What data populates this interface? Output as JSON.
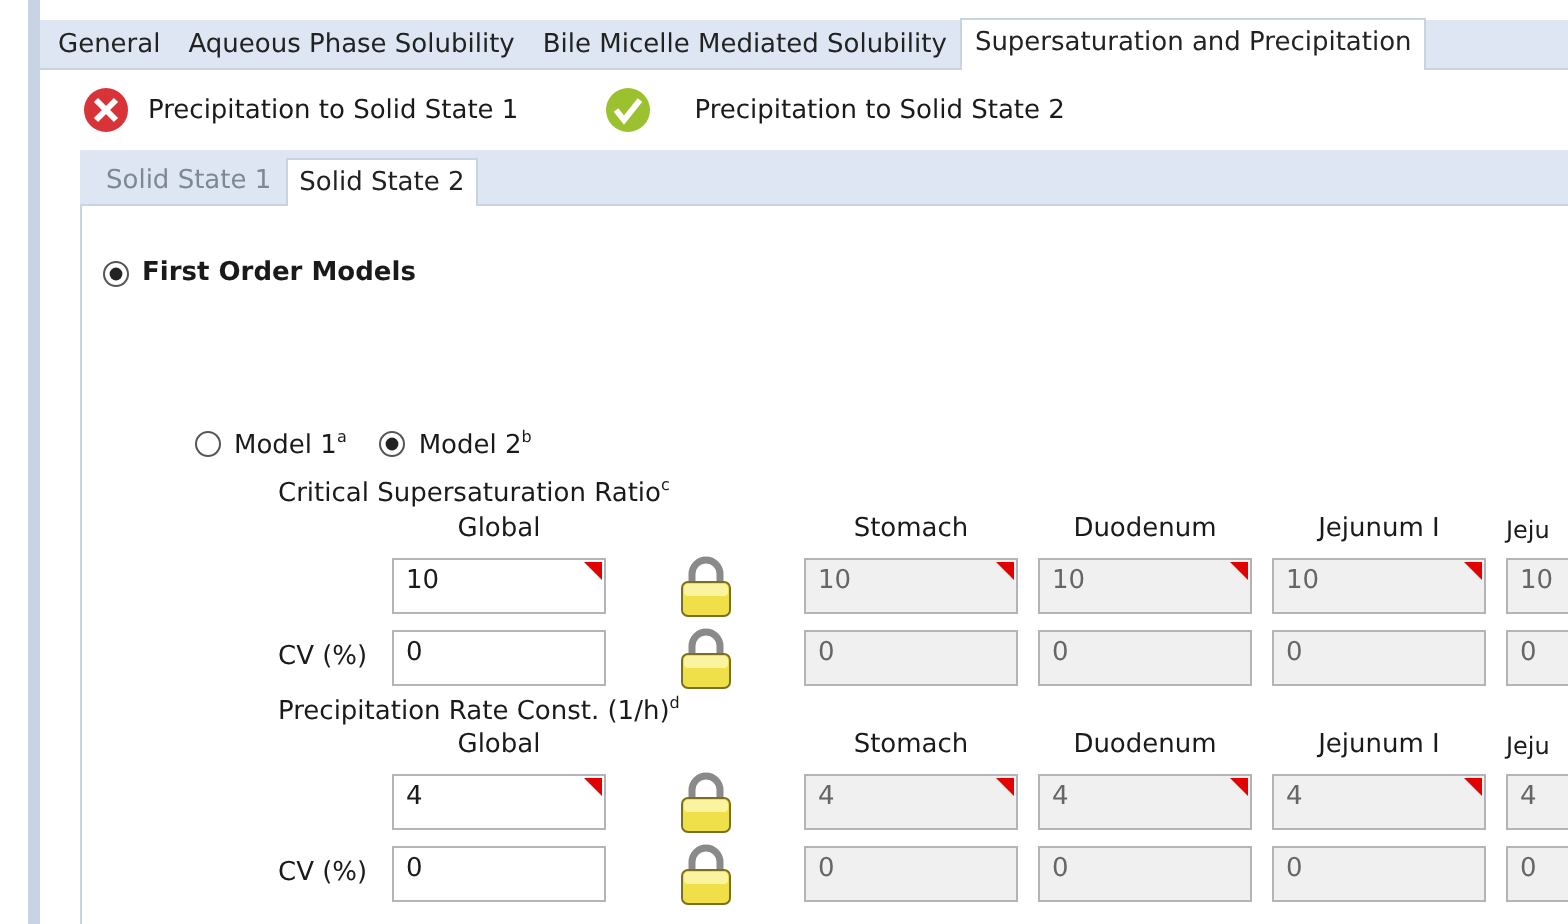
{
  "main_tabs": [
    {
      "label": "General",
      "selected": false
    },
    {
      "label": "Aqueous Phase Solubility",
      "selected": false
    },
    {
      "label": "Bile Micelle Mediated Solubility",
      "selected": false
    },
    {
      "label": "Supersaturation and Precipitation",
      "selected": true
    }
  ],
  "statuses": [
    {
      "kind": "error",
      "label": "Precipitation to Solid State 1"
    },
    {
      "kind": "ok",
      "label": "Precipitation to Solid State 2"
    }
  ],
  "sub_tabs": [
    {
      "label": "Solid State 1",
      "selected": false,
      "disabled": true
    },
    {
      "label": "Solid State 2",
      "selected": true,
      "disabled": false
    }
  ],
  "model_type": {
    "label": "First Order Models",
    "selected": true
  },
  "models": [
    {
      "label": "Model 1$^{a}$",
      "selected": false
    },
    {
      "label": "Model 2$^{b}$",
      "selected": true
    }
  ],
  "sections": [
    {
      "title": "Critical Supersaturation Ratio$^{c}$",
      "columns": [
        "Global",
        "Stomach",
        "Duodenum",
        "Jejunum I",
        "Jeju"
      ],
      "rows": [
        {
          "global": {
            "value": "10",
            "marked": true
          },
          "locked": true,
          "cells": [
            {
              "value": "10",
              "marked": true
            },
            {
              "value": "10",
              "marked": true
            },
            {
              "value": "10",
              "marked": true
            },
            {
              "value": "10",
              "marked": false
            }
          ]
        },
        {
          "label": "CV (%)",
          "global": {
            "value": "0",
            "marked": false
          },
          "locked": true,
          "cells": [
            {
              "value": "0",
              "marked": false
            },
            {
              "value": "0",
              "marked": false
            },
            {
              "value": "0",
              "marked": false
            },
            {
              "value": "0",
              "marked": false
            }
          ]
        }
      ]
    },
    {
      "title": "Precipitation Rate Const. (1/h)$^{d}$",
      "columns": [
        "Global",
        "Stomach",
        "Duodenum",
        "Jejunum I",
        "Jeju"
      ],
      "rows": [
        {
          "global": {
            "value": "4",
            "marked": true
          },
          "locked": true,
          "cells": [
            {
              "value": "4",
              "marked": true
            },
            {
              "value": "4",
              "marked": true
            },
            {
              "value": "4",
              "marked": true
            },
            {
              "value": "4",
              "marked": false
            }
          ]
        },
        {
          "label": "CV (%)",
          "global": {
            "value": "0",
            "marked": false
          },
          "locked": true,
          "cells": [
            {
              "value": "0",
              "marked": false
            },
            {
              "value": "0",
              "marked": false
            },
            {
              "value": "0",
              "marked": false
            },
            {
              "value": "0",
              "marked": false
            }
          ]
        }
      ]
    }
  ]
}
